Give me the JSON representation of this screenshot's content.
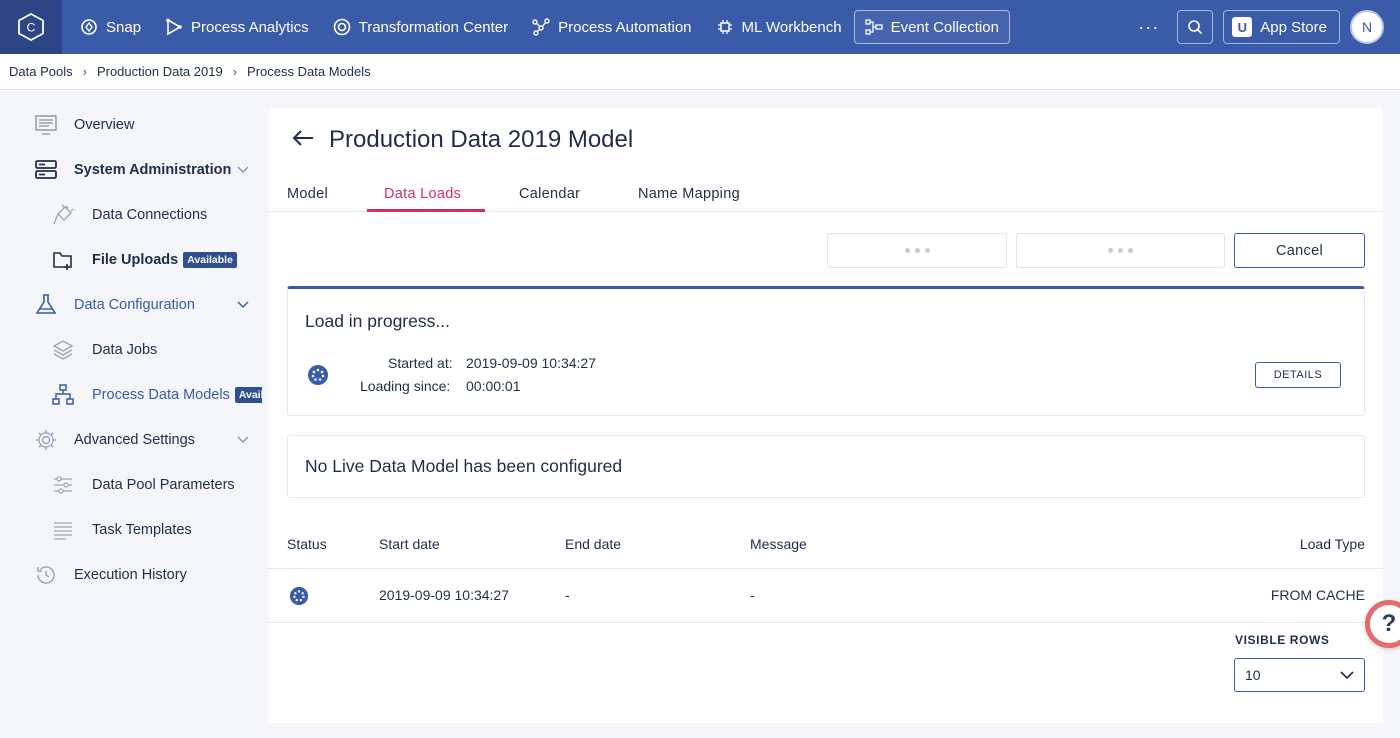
{
  "topbar": {
    "logo": "C",
    "nav": [
      {
        "label": "Snap",
        "icon": "snap-icon"
      },
      {
        "label": "Process Analytics",
        "icon": "process-analytics-icon"
      },
      {
        "label": "Transformation Center",
        "icon": "transformation-center-icon"
      },
      {
        "label": "Process Automation",
        "icon": "process-automation-icon"
      },
      {
        "label": "ML Workbench",
        "icon": "ml-workbench-icon"
      },
      {
        "label": "Event Collection",
        "icon": "event-collection-icon",
        "active": true
      }
    ],
    "more": "···",
    "app_store_badge": "U",
    "app_store": "App Store",
    "avatar": "N",
    "colors": {
      "bar": "#3a5ba8",
      "logo_bg": "#2b4585"
    }
  },
  "breadcrumb": [
    "Data Pools",
    "Production Data 2019",
    "Process Data Models"
  ],
  "sidebar": {
    "items": [
      {
        "label": "Overview",
        "icon": "overview-icon"
      },
      {
        "label": "System Administration",
        "icon": "server-icon"
      },
      {
        "label": "Data Connections",
        "icon": "plug-icon"
      },
      {
        "label": "File Uploads",
        "icon": "folder-plus-icon",
        "badge": "Available"
      },
      {
        "label": "Data Configuration",
        "icon": "flask-icon"
      },
      {
        "label": "Data Jobs",
        "icon": "layers-icon"
      },
      {
        "label": "Process Data Models",
        "icon": "hierarchy-icon",
        "badge": "Available"
      },
      {
        "label": "Advanced Settings",
        "icon": "gear-icon"
      },
      {
        "label": "Data Pool Parameters",
        "icon": "sliders-icon"
      },
      {
        "label": "Task Templates",
        "icon": "lines-icon"
      },
      {
        "label": "Execution History",
        "icon": "history-icon"
      }
    ]
  },
  "main": {
    "title": "Production Data 2019 Model",
    "tabs": [
      "Model",
      "Data Loads",
      "Calendar",
      "Name Mapping"
    ],
    "active_tab": "Data Loads",
    "cancel": "Cancel",
    "progress_card": {
      "heading": "Load in progress...",
      "started_label": "Started at:",
      "started_value": "2019-09-09 10:34:27",
      "loading_label": "Loading since:",
      "loading_value": "00:00:01",
      "details": "DETAILS"
    },
    "live_card": {
      "message": "No Live Data Model has been configured"
    },
    "table": {
      "headers": [
        "Status",
        "Start date",
        "End date",
        "Message",
        "Load Type"
      ],
      "rows": [
        {
          "start": "2019-09-09 10:34:27",
          "end": "-",
          "message": "-",
          "load_type": "FROM CACHE"
        }
      ]
    },
    "visible_rows_label": "VISIBLE ROWS",
    "visible_rows_value": "10",
    "accent": "#d0315c"
  },
  "help": "?"
}
